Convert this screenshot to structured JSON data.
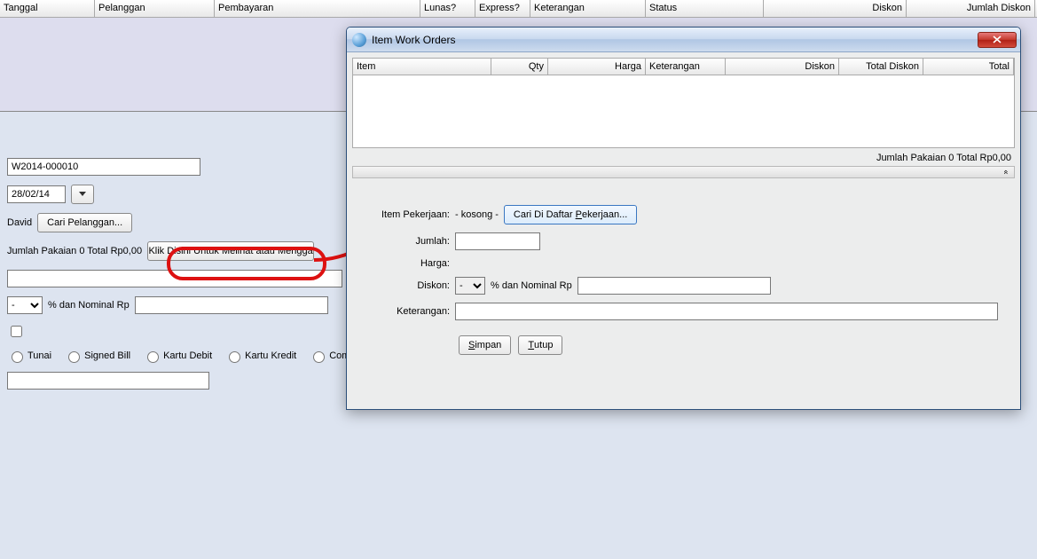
{
  "main_table": {
    "headers": {
      "tanggal": "Tanggal",
      "pelanggan": "Pelanggan",
      "pembayaran": "Pembayaran",
      "lunas": "Lunas?",
      "express": "Express?",
      "keterangan": "Keterangan",
      "status": "Status",
      "diskon": "Diskon",
      "jumlah_diskon": "Jumlah Diskon"
    }
  },
  "form": {
    "order_no": "W2014-000010",
    "date": "28/02/14",
    "customer_name": "David",
    "find_customer_btn": "Cari Pelanggan...",
    "summary": "Jumlah Pakaian 0   Total Rp0,00",
    "detail_btn": "Klik Disini Untuk Melihat atau Mengga",
    "disc_label": "% dan Nominal Rp",
    "pay_options": {
      "tunai": "Tunai",
      "signed_bill": "Signed Bill",
      "kartu_debit": "Kartu Debit",
      "kartu_kredit": "Kartu Kredit",
      "compl": "Compl"
    }
  },
  "dialog": {
    "title": "Item Work Orders",
    "headers": {
      "item": "Item",
      "qty": "Qty",
      "harga": "Harga",
      "keterangan": "Keterangan",
      "diskon": "Diskon",
      "total_diskon": "Total Diskon",
      "total": "Total"
    },
    "summary": "Jumlah Pakaian 0   Total Rp0,00",
    "collapse_icon": "«",
    "form": {
      "item_label": "Item Pekerjaan:",
      "item_value": "- kosong -",
      "item_search_btn": "Cari Di Daftar Pekerjaan...",
      "jumlah_label": "Jumlah:",
      "harga_label": "Harga:",
      "diskon_label": "Diskon:",
      "diskon_select": "-",
      "diskon_suffix": "% dan Nominal Rp",
      "keterangan_label": "Keterangan:"
    },
    "buttons": {
      "simpan": "Simpan",
      "tutup": "Tutup"
    }
  }
}
